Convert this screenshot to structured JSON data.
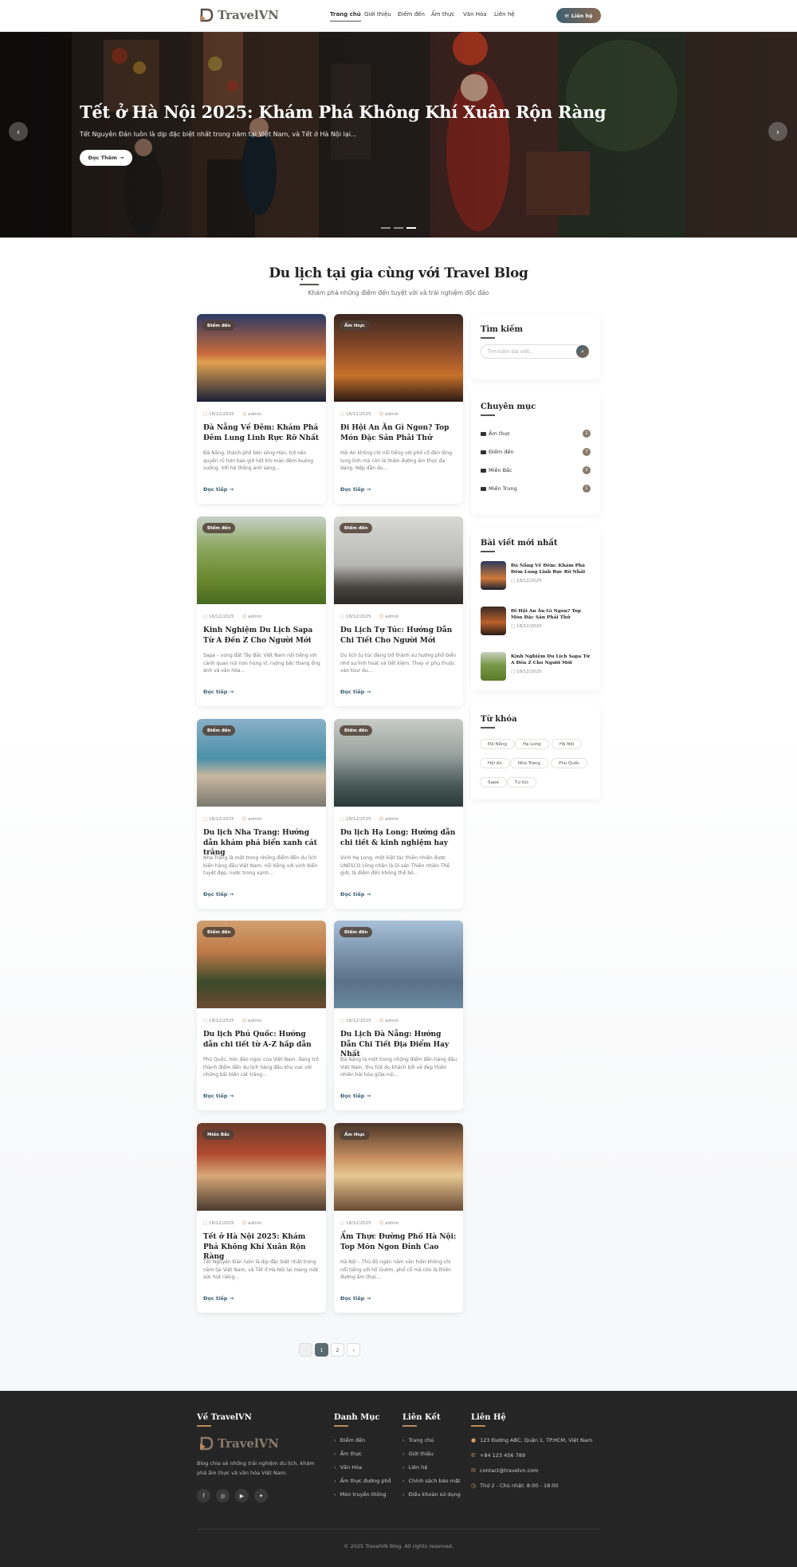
{
  "header": {
    "logo": "TravelVN",
    "nav": [
      "Trang chủ",
      "Giới thiệu",
      "Điểm đến",
      "Ẩm thực",
      "Văn Hóa",
      "Liên hệ"
    ],
    "contact_button": "Liên hệ"
  },
  "hero": {
    "title": "Tết ở Hà Nội 2025: Khám Phá Không Khí Xuân Rộn Ràng",
    "subtitle": "Tết Nguyên Đán luôn là dịp đặc biệt nhất trong năm tại Việt Nam, và Tết ở Hà Nội lại...",
    "button": "Đọc Thêm",
    "active_slide": 3,
    "slide_count": 3
  },
  "section": {
    "title": "Du lịch tại gia cùng với Travel Blog",
    "subtitle": "Khám phá những điểm đến tuyệt vời và trải nghiệm độc đáo"
  },
  "posts": [
    {
      "badge": "Điểm đến",
      "date": "18/12/2025",
      "author": "admin",
      "title": "Đà Nẵng Về Đêm: Khám Phá Đêm Lung Linh Rực Rỡ Nhất",
      "excerpt": "Đà Nẵng, thành phố bên sông Hàn, trở nên quyến rũ hơn bao giờ hết khi màn đêm buông xuống. Với hệ thống ánh sáng...",
      "more": "Đọc tiếp"
    },
    {
      "badge": "Ẩm thực",
      "date": "18/12/2025",
      "author": "admin",
      "title": "Đi Hội An Ăn Gì Ngon? Top Món Đặc Sản Phải Thử",
      "excerpt": "Hội An không chỉ nổi tiếng với phố cổ đèn lồng lung linh mà còn là thiên đường ẩm thực đa dạng. Nếp dẫn du...",
      "more": "Đọc tiếp"
    },
    {
      "badge": "Điểm đến",
      "date": "18/12/2025",
      "author": "admin",
      "title": "Kinh Nghiệm Du Lịch Sapa Từ A Đến Z Cho Người Mới",
      "excerpt": "Sapa – vùng đất Tây Bắc Việt Nam nổi tiếng với cảnh quan núi non hùng vĩ, ruộng bậc thang ống ánh và văn hóa...",
      "more": "Đọc tiếp"
    },
    {
      "badge": "Điểm đến",
      "date": "18/12/2025",
      "author": "admin",
      "title": "Du Lịch Tự Túc: Hướng Dẫn Chi Tiết Cho Người Mới",
      "excerpt": "Du lịch tự túc đang trở thành xu hướng phổ biến nhờ sự linh hoạt và tiết kiệm. Thay vì phụ thuộc vào tour du...",
      "more": "Đọc tiếp"
    },
    {
      "badge": "Điểm đến",
      "date": "18/12/2025",
      "author": "admin",
      "title": "Du lịch Nha Trang: Hướng dẫn khám phá biển xanh cát trắng",
      "excerpt": "Nha Trang là một trong những điểm đến du lịch biển hàng đầu Việt Nam, nổi tiếng với vịnh biển tuyệt đẹp, nước trong xanh...",
      "more": "Đọc tiếp"
    },
    {
      "badge": "Điểm đến",
      "date": "18/12/2025",
      "author": "admin",
      "title": "Du lịch Hạ Long: Hướng dẫn chi tiết & kinh nghiệm hay",
      "excerpt": "Vịnh Hạ Long, một kiệt tác thiên nhiên được UNESCO công nhận là Di sản Thiên nhiên Thế giới, là điểm đến không thể bỏ...",
      "more": "Đọc tiếp"
    },
    {
      "badge": "Điểm đến",
      "date": "18/12/2025",
      "author": "admin",
      "title": "Du lịch Phú Quốc: Hướng dẫn chi tiết từ A-Z hấp dẫn",
      "excerpt": "Phú Quốc, hòn đảo ngọc của Việt Nam, đang trở thành điểm đến du lịch hàng đầu khu vực với những bãi biển cát trắng...",
      "more": "Đọc tiếp"
    },
    {
      "badge": "Điểm đến",
      "date": "18/12/2025",
      "author": "admin",
      "title": "Du Lịch Đà Nẵng: Hướng Dẫn Chi Tiết Địa Điểm Hay Nhất",
      "excerpt": "Đà Nẵng là một trong những điểm đến hàng đầu Việt Nam, thu hút du khách bởi vẻ đẹp thiên nhiên hài hòa giữa núi...",
      "more": "Đọc tiếp"
    },
    {
      "badge": "Miền Bắc",
      "date": "18/12/2025",
      "author": "admin",
      "title": "Tết ở Hà Nội 2025: Khám Phá Không Khí Xuân Rộn Ràng",
      "excerpt": "Tết Nguyên Đán luôn là dịp đặc biệt nhất trong năm tại Việt Nam, và Tết ở Hà Nội lại mang một sức hút riêng...",
      "more": "Đọc tiếp"
    },
    {
      "badge": "Ẩm thực",
      "date": "18/12/2025",
      "author": "admin",
      "title": "Ẩm Thực Đường Phố Hà Nội: Top Món Ngon Đỉnh Cao",
      "excerpt": "Hà Nội – Thủ đô ngàn năm văn hiến không chỉ nổi tiếng với hồ Gươm, phố cổ mà còn là thiên đường ẩm thực...",
      "more": "Đọc tiếp"
    }
  ],
  "sidebar": {
    "search_title": "Tìm kiếm",
    "search_placeholder": "Tìm kiếm bài viết...",
    "categories_title": "Chuyên mục",
    "categories": [
      {
        "name": "Ẩm thực",
        "count": "2"
      },
      {
        "name": "Điểm đến",
        "count": "7"
      },
      {
        "name": "Miền Bắc",
        "count": "2"
      },
      {
        "name": "Miền Trung",
        "count": "1"
      }
    ],
    "recent_title": "Bài viết mới nhất",
    "recent": [
      {
        "title": "Đà Nẵng Về Đêm: Khám Phá Đêm Lung Linh Rực Rỡ Nhất",
        "date": "18/12/2025"
      },
      {
        "title": "Đi Hội An Ăn Gì Ngon? Top Món Đặc Sản Phải Thử",
        "date": "18/12/2025"
      },
      {
        "title": "Kinh Nghiệm Du Lịch Sapa Từ A Đến Z Cho Người Mới",
        "date": "18/12/2025"
      }
    ],
    "tags_title": "Từ khóa",
    "tags": [
      "Đà Nẵng",
      "Hạ Long",
      "Hà Nội",
      "Hội An",
      "Nha Trang",
      "Phú Quốc",
      "Sapa",
      "Tự túc"
    ]
  },
  "pagination": {
    "prev": "‹",
    "pages": [
      "1",
      "2"
    ],
    "next": "›",
    "current": "1"
  },
  "footer": {
    "about_title": "Về TravelVN",
    "logo": "TravelVN",
    "description": "Blog chia sẻ những trải nghiệm du lịch, khám phá ẩm thực và văn hóa Việt Nam.",
    "categories_title": "Danh Mục",
    "categories": [
      "Điểm đến",
      "Ẩm thực",
      "Văn Hóa",
      "Ẩm thực đường phố",
      "Món truyền thống"
    ],
    "links_title": "Liên Kết",
    "links": [
      "Trang chủ",
      "Giới thiệu",
      "Liên hệ",
      "Chính sách bảo mật",
      "Điều khoản sử dụng"
    ],
    "contact_title": "Liên Hệ",
    "contact": [
      {
        "icon": "location-icon",
        "text": "123 Đường ABC, Quận 1, TP.HCM, Việt Nam"
      },
      {
        "icon": "phone-icon",
        "text": "+84 123 456 789"
      },
      {
        "icon": "email-icon",
        "text": "contact@travelvn.com"
      },
      {
        "icon": "clock-icon",
        "text": "Thứ 2 - Chủ nhật: 8:00 - 18:00"
      }
    ],
    "social": [
      "f",
      "◎",
      "▶",
      "✦"
    ],
    "copyright": "© 2025 TravelVN Blog. All rights reserved."
  },
  "colors": {
    "accent": "#3d5f70",
    "brand_brown": "#8a6b52",
    "footer_bg": "#252525"
  }
}
